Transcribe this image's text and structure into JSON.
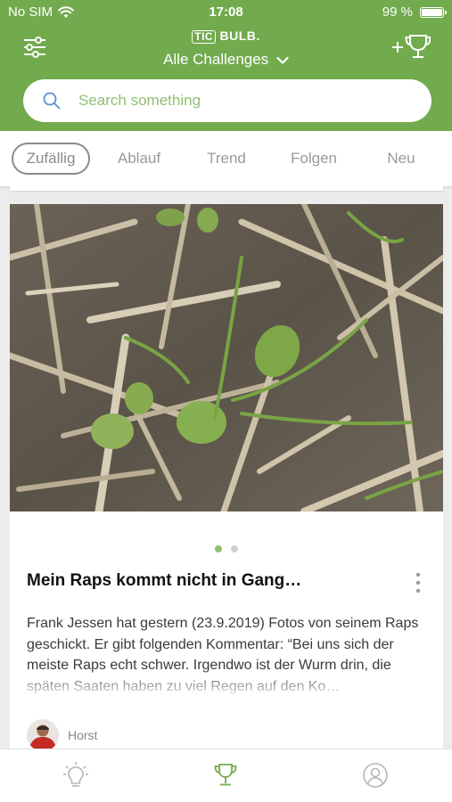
{
  "status_bar": {
    "carrier": "No SIM",
    "time": "17:08",
    "battery": "99 %",
    "battery_level": 0.99
  },
  "header": {
    "logo_boxed": "TIC",
    "logo_text": "BULB.",
    "challenge_filter": "Alle Challenges"
  },
  "search": {
    "placeholder": "Search something",
    "value": ""
  },
  "tabs": [
    {
      "label": "Zufällig",
      "active": true
    },
    {
      "label": "Ablauf",
      "active": false
    },
    {
      "label": "Trend",
      "active": false
    },
    {
      "label": "Folgen",
      "active": false
    },
    {
      "label": "Neu",
      "active": false
    }
  ],
  "post": {
    "image_pages": 2,
    "current_page": 1,
    "title": "Mein Raps kommt nicht in Gang…",
    "body": "Frank Jessen hat gestern (23.9.2019) Fotos von seinem Raps geschickt. Er gibt folgenden Kommentar: “Bei uns sich der meiste Raps echt schwer. Irgendwo ist der Wurm drin, die späten Saaten haben zu viel Regen auf den Ko…",
    "author": "Horst"
  },
  "bottom_nav": [
    {
      "icon": "lightbulb-icon",
      "active": false
    },
    {
      "icon": "trophy-icon",
      "active": true
    },
    {
      "icon": "profile-icon",
      "active": false
    }
  ],
  "colors": {
    "brand_green": "#72ab4e",
    "placeholder_green": "#8fbf72",
    "active_dot": "#8fc06e"
  }
}
